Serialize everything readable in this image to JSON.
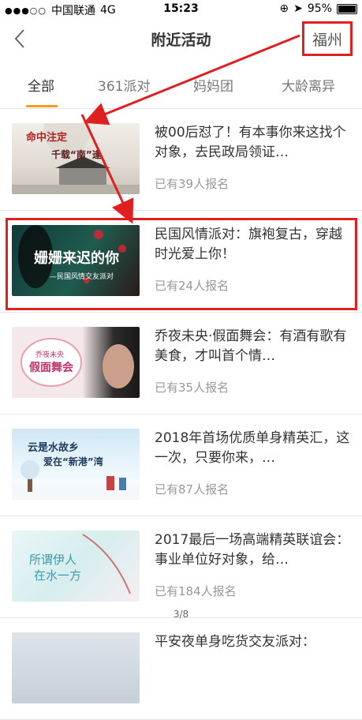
{
  "status_bar": {
    "carrier": "中国联通",
    "network": "4G",
    "time": "15:23",
    "battery": "95%"
  },
  "nav": {
    "title": "附近活动",
    "city": "福州"
  },
  "tabs": [
    {
      "label": "全部"
    },
    {
      "label": "361派对"
    },
    {
      "label": "妈妈团"
    },
    {
      "label": "大龄离异"
    }
  ],
  "events": [
    {
      "title": "被00后怼了！有本事你来这找个对象，去民政局领证…",
      "count": "已有39人报名",
      "thumb_text": [
        "命中注定",
        "千载“南”逢"
      ]
    },
    {
      "title": "民国风情派对：旗袍复古，穿越时光爱上你！",
      "count": "已有24人报名",
      "thumb_text": [
        "姗姗来迟的你",
        "—民国风情交友派对"
      ]
    },
    {
      "title": "乔夜未央·假面舞会：有酒有歌有美食，才叫首个情…",
      "count": "已有35人报名",
      "thumb_text": [
        "乔夜未央",
        "假面舞会"
      ]
    },
    {
      "title": "2018年首场优质单身精英汇，这一次，只要你来，…",
      "count": "已有87人报名",
      "thumb_text": [
        "云是水故乡",
        "爱在“新港”湾"
      ]
    },
    {
      "title": "2017最后一场高端精英联谊会：事业单位好对象，给…",
      "count": "已有184人报名",
      "thumb_text": [
        "所谓伊人",
        "在水一方"
      ]
    },
    {
      "title": "平安夜单身吃货交友派对：",
      "count": "",
      "thumb_text": []
    }
  ],
  "page_indicator": "3/8",
  "colors": {
    "accent": "#ff9a1f",
    "highlight": "#e02020"
  }
}
